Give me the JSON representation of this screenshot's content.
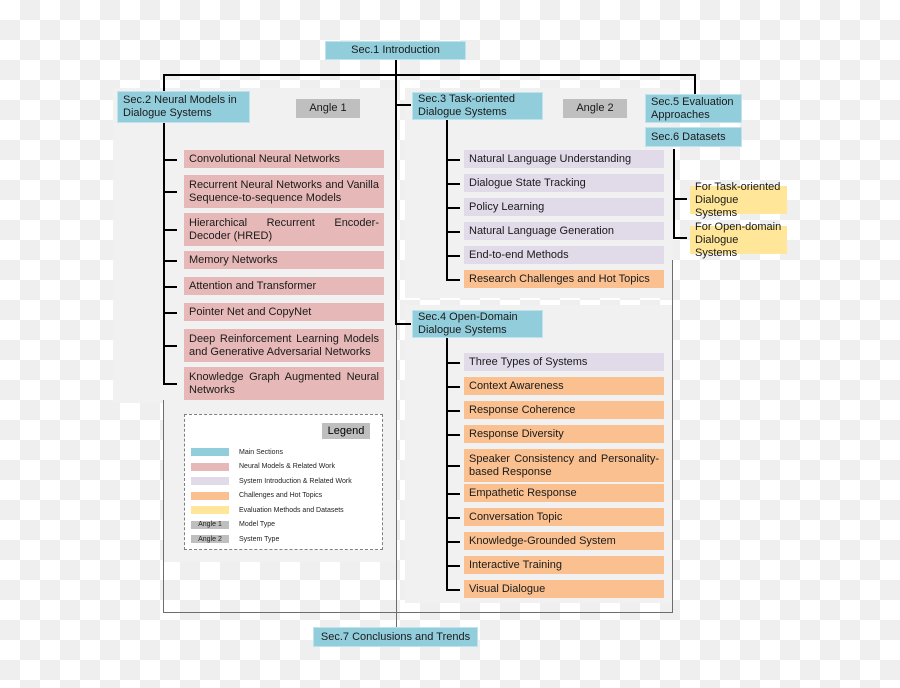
{
  "title": "Sec.1  Introduction",
  "sections": {
    "sec2": "Sec.2  Neural Models in Dialogue Systems",
    "sec3": "Sec.3  Task-oriented Dialogue Systems",
    "sec4": "Sec.4  Open-Domain Dialogue Systems",
    "sec5": "Sec.5  Evaluation Approaches",
    "sec6": "Sec.6  Datasets",
    "sec7": "Sec.7  Conclusions and Trends"
  },
  "angles": {
    "angle1": "Angle 1",
    "angle2": "Angle 2"
  },
  "neural_models": [
    "Convolutional Neural Networks",
    "Recurrent Neural Networks and Vanilla Sequence-to-sequence Models",
    "Hierarchical Recurrent Encoder-Decoder (HRED)",
    "Memory Networks",
    "Attention and Transformer",
    "Pointer Net and CopyNet",
    "Deep Reinforcement Learning Models and Generative Adversarial Networks",
    "Knowledge Graph Augmented Neural Networks"
  ],
  "task_oriented": [
    {
      "label": "Natural Language Understanding",
      "type": "system"
    },
    {
      "label": "Dialogue State Tracking",
      "type": "system"
    },
    {
      "label": "Policy Learning",
      "type": "system"
    },
    {
      "label": "Natural Language Generation",
      "type": "system"
    },
    {
      "label": "End-to-end Methods",
      "type": "system"
    },
    {
      "label": "Research Challenges and Hot Topics",
      "type": "challenge"
    }
  ],
  "open_domain": [
    {
      "label": "Three Types of Systems",
      "type": "system"
    },
    {
      "label": "Context Awareness",
      "type": "challenge"
    },
    {
      "label": "Response Coherence",
      "type": "challenge"
    },
    {
      "label": "Response Diversity",
      "type": "challenge"
    },
    {
      "label": "Speaker Consistency and Personality-based Response",
      "type": "challenge"
    },
    {
      "label": "Empathetic Response",
      "type": "challenge"
    },
    {
      "label": "Conversation Topic",
      "type": "challenge"
    },
    {
      "label": "Knowledge-Grounded System",
      "type": "challenge"
    },
    {
      "label": "Interactive Training",
      "type": "challenge"
    },
    {
      "label": "Visual Dialogue",
      "type": "challenge"
    }
  ],
  "datasets": [
    "For Task-oriented Dialogue Systems",
    "For Open-domain Dialogue Systems"
  ],
  "legend": {
    "title": "Legend",
    "items": [
      {
        "swatch": "",
        "color": "#92cddc",
        "label": "Main Sections"
      },
      {
        "swatch": "",
        "color": "#e6b9b8",
        "label": "Neural Models & Related Work"
      },
      {
        "swatch": "",
        "color": "#e0dae9",
        "label": "System Introduction & Related Work"
      },
      {
        "swatch": "",
        "color": "#fac090",
        "label": "Challenges and Hot Topics"
      },
      {
        "swatch": "",
        "color": "#ffe699",
        "label": "Evaluation Methods and Datasets"
      },
      {
        "swatch": "Angle 1",
        "color": "#bfbfbf",
        "label": "Model Type"
      },
      {
        "swatch": "Angle 2",
        "color": "#bfbfbf",
        "label": "System Type"
      }
    ]
  },
  "colors": {
    "main_section": "#92cddc",
    "neural_models": "#e6b9b8",
    "system_intro": "#e0dae9",
    "challenges": "#fac090",
    "evaluation": "#ffe699",
    "angle": "#bfbfbf"
  }
}
